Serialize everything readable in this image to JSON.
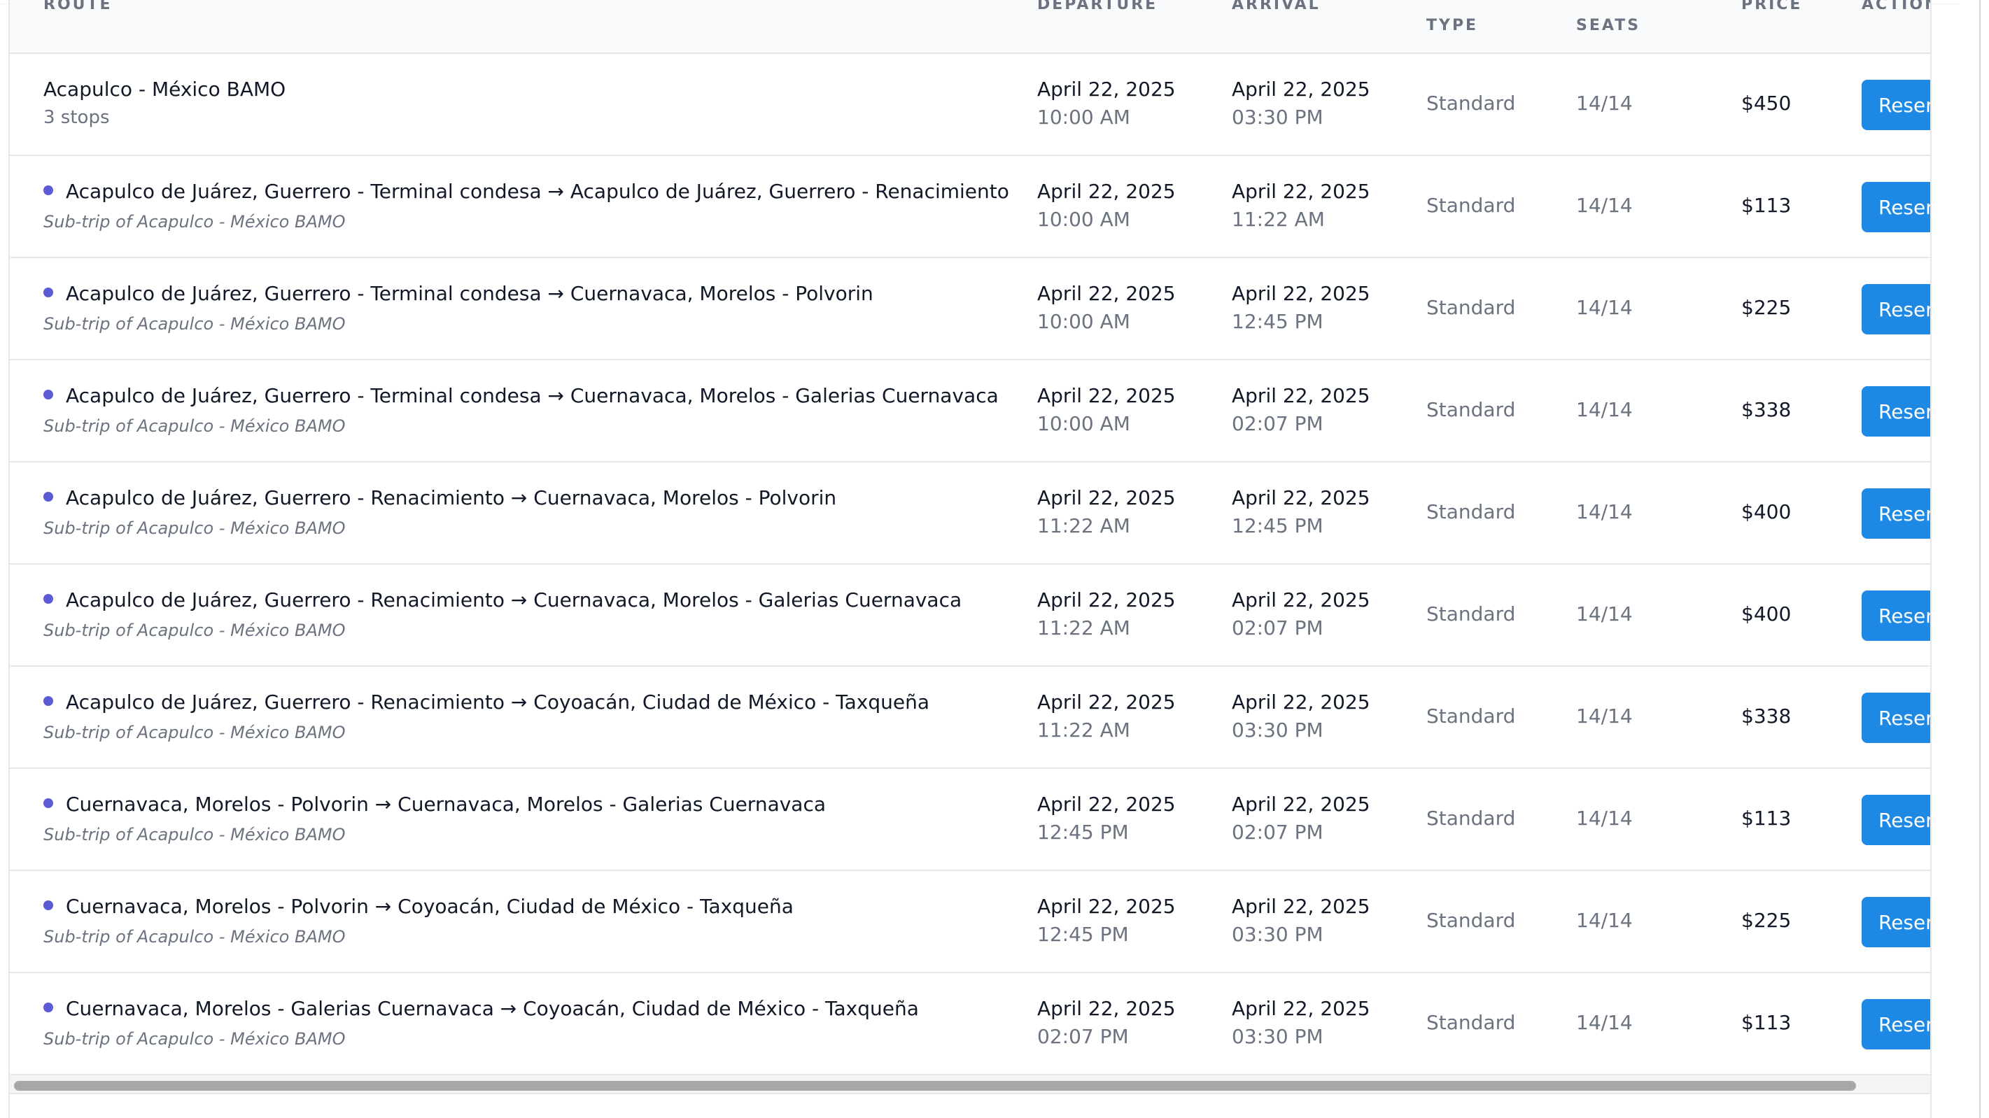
{
  "header": {
    "route": "Route",
    "departure": "Departure",
    "arrival": "Arrival",
    "type": "Type",
    "seats": "Seats",
    "price": "Price",
    "action": "Action"
  },
  "reserve_label": "Reserve",
  "main_trip": {
    "route": "Acapulco - México BAMO",
    "stops": "3 stops",
    "dep_date": "April 22, 2025",
    "dep_time": "10:00 AM",
    "arr_date": "April 22, 2025",
    "arr_time": "03:30 PM",
    "type": "Standard",
    "seats": "14/14",
    "price": "$450"
  },
  "subtrips": [
    {
      "route": "Acapulco de Juárez, Guerrero - Terminal condesa → Acapulco de Juárez, Guerrero - Renacimiento",
      "note": "Sub-trip of Acapulco - México BAMO",
      "dep_date": "April 22, 2025",
      "dep_time": "10:00 AM",
      "arr_date": "April 22, 2025",
      "arr_time": "11:22 AM",
      "type": "Standard",
      "seats": "14/14",
      "price": "$113"
    },
    {
      "route": "Acapulco de Juárez, Guerrero - Terminal condesa → Cuernavaca, Morelos - Polvorin",
      "note": "Sub-trip of Acapulco - México BAMO",
      "dep_date": "April 22, 2025",
      "dep_time": "10:00 AM",
      "arr_date": "April 22, 2025",
      "arr_time": "12:45 PM",
      "type": "Standard",
      "seats": "14/14",
      "price": "$225"
    },
    {
      "route": "Acapulco de Juárez, Guerrero - Terminal condesa → Cuernavaca, Morelos - Galerias Cuernavaca",
      "note": "Sub-trip of Acapulco - México BAMO",
      "dep_date": "April 22, 2025",
      "dep_time": "10:00 AM",
      "arr_date": "April 22, 2025",
      "arr_time": "02:07 PM",
      "type": "Standard",
      "seats": "14/14",
      "price": "$338"
    },
    {
      "route": "Acapulco de Juárez, Guerrero - Renacimiento → Cuernavaca, Morelos - Polvorin",
      "note": "Sub-trip of Acapulco - México BAMO",
      "dep_date": "April 22, 2025",
      "dep_time": "11:22 AM",
      "arr_date": "April 22, 2025",
      "arr_time": "12:45 PM",
      "type": "Standard",
      "seats": "14/14",
      "price": "$400"
    },
    {
      "route": "Acapulco de Juárez, Guerrero - Renacimiento → Cuernavaca, Morelos - Galerias Cuernavaca",
      "note": "Sub-trip of Acapulco - México BAMO",
      "dep_date": "April 22, 2025",
      "dep_time": "11:22 AM",
      "arr_date": "April 22, 2025",
      "arr_time": "02:07 PM",
      "type": "Standard",
      "seats": "14/14",
      "price": "$400"
    },
    {
      "route": "Acapulco de Juárez, Guerrero - Renacimiento → Coyoacán, Ciudad de México - Taxqueña",
      "note": "Sub-trip of Acapulco - México BAMO",
      "dep_date": "April 22, 2025",
      "dep_time": "11:22 AM",
      "arr_date": "April 22, 2025",
      "arr_time": "03:30 PM",
      "type": "Standard",
      "seats": "14/14",
      "price": "$338"
    },
    {
      "route": "Cuernavaca, Morelos - Polvorin → Cuernavaca, Morelos - Galerias Cuernavaca",
      "note": "Sub-trip of Acapulco - México BAMO",
      "dep_date": "April 22, 2025",
      "dep_time": "12:45 PM",
      "arr_date": "April 22, 2025",
      "arr_time": "02:07 PM",
      "type": "Standard",
      "seats": "14/14",
      "price": "$113"
    },
    {
      "route": "Cuernavaca, Morelos - Polvorin → Coyoacán, Ciudad de México - Taxqueña",
      "note": "Sub-trip of Acapulco - México BAMO",
      "dep_date": "April 22, 2025",
      "dep_time": "12:45 PM",
      "arr_date": "April 22, 2025",
      "arr_time": "03:30 PM",
      "type": "Standard",
      "seats": "14/14",
      "price": "$225"
    },
    {
      "route": "Cuernavaca, Morelos - Galerias Cuernavaca → Coyoacán, Ciudad de México - Taxqueña",
      "note": "Sub-trip of Acapulco - México BAMO",
      "dep_date": "April 22, 2025",
      "dep_time": "02:07 PM",
      "arr_date": "April 22, 2025",
      "arr_time": "03:30 PM",
      "type": "Standard",
      "seats": "14/14",
      "price": "$113"
    }
  ],
  "colors": {
    "accent": "#1e88e5",
    "subtrip_dot": "#5b5bd6",
    "muted_text": "#6b7280",
    "border": "#e5e7eb"
  }
}
